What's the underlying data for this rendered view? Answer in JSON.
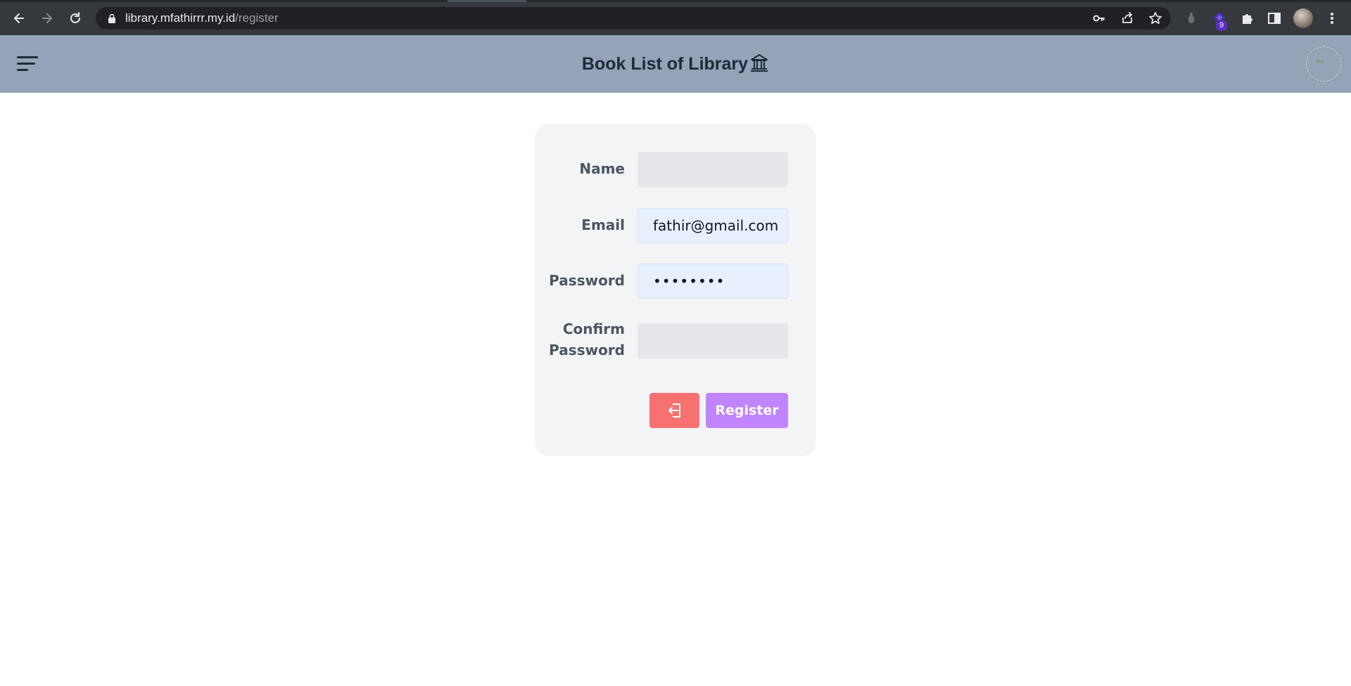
{
  "browser": {
    "url_host": "library.mfathirrr.my.id",
    "url_path": "/register",
    "extension_badge": "9"
  },
  "header": {
    "title": "Book List of Library"
  },
  "form": {
    "name_label": "Name",
    "email_label": "Email",
    "password_label": "Password",
    "confirm_label_line1": "Confirm",
    "confirm_label_line2": "Password",
    "name_value": "",
    "email_value": "fathir@gmail.com",
    "password_value": "••••••••",
    "confirm_value": "",
    "register_label": "Register"
  },
  "colors": {
    "header_bg": "#94a3b8",
    "card_bg": "#f3f4f6",
    "login_button": "#f87171",
    "register_button": "#c084fc"
  }
}
